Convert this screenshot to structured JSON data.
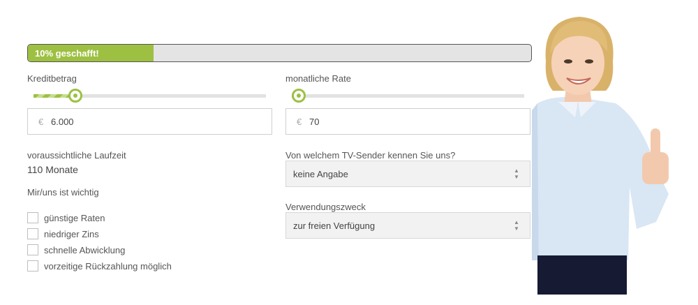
{
  "progress": {
    "text": "10% geschafft!",
    "percent": 25
  },
  "credit": {
    "label": "Kreditbetrag",
    "slider_fraction": 0.18,
    "currency": "€",
    "value": "6.000"
  },
  "monthly": {
    "label": "monatliche Rate",
    "slider_fraction": 0.03,
    "currency": "€",
    "value": "70"
  },
  "duration": {
    "label": "voraussichtliche Laufzeit",
    "value": "110 Monate"
  },
  "important": {
    "label": "Mir/uns ist wichtig",
    "options": [
      "günstige Raten",
      "niedriger Zins",
      "schnelle Abwicklung",
      "vorzeitige Rückzahlung möglich"
    ]
  },
  "tv": {
    "label": "Von welchem TV-Sender kennen Sie uns?",
    "selected": "keine Angabe"
  },
  "purpose": {
    "label": "Verwendungszweck",
    "selected": "zur freien Verfügung"
  },
  "colors": {
    "accent": "#9dc042",
    "track": "#e2e2e2"
  }
}
